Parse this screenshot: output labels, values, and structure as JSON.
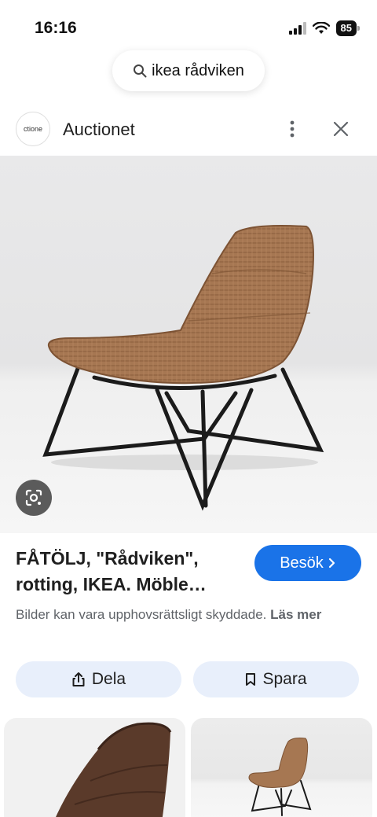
{
  "status_bar": {
    "time": "16:16",
    "battery": "85"
  },
  "search": {
    "query": "ikea rådviken"
  },
  "source": {
    "favicon_text": "ctione",
    "name": "Auctionet"
  },
  "result": {
    "title": "FÅTÖLJ, \"Rådviken\", rotting, IKEA. Möble…",
    "visit_label": "Besök",
    "copyright_text": "Bilder kan vara upphovsrättsligt skyddade.",
    "copyright_more": "Läs mer"
  },
  "actions": {
    "share_label": "Dela",
    "save_label": "Spara"
  },
  "colors": {
    "accent": "#1a73e8",
    "action_bg": "#e8effb",
    "wicker": "#a67752"
  },
  "icons": [
    "search-icon",
    "more-vert-icon",
    "close-icon",
    "lens-icon",
    "chevron-right-icon",
    "share-icon",
    "bookmark-icon"
  ]
}
